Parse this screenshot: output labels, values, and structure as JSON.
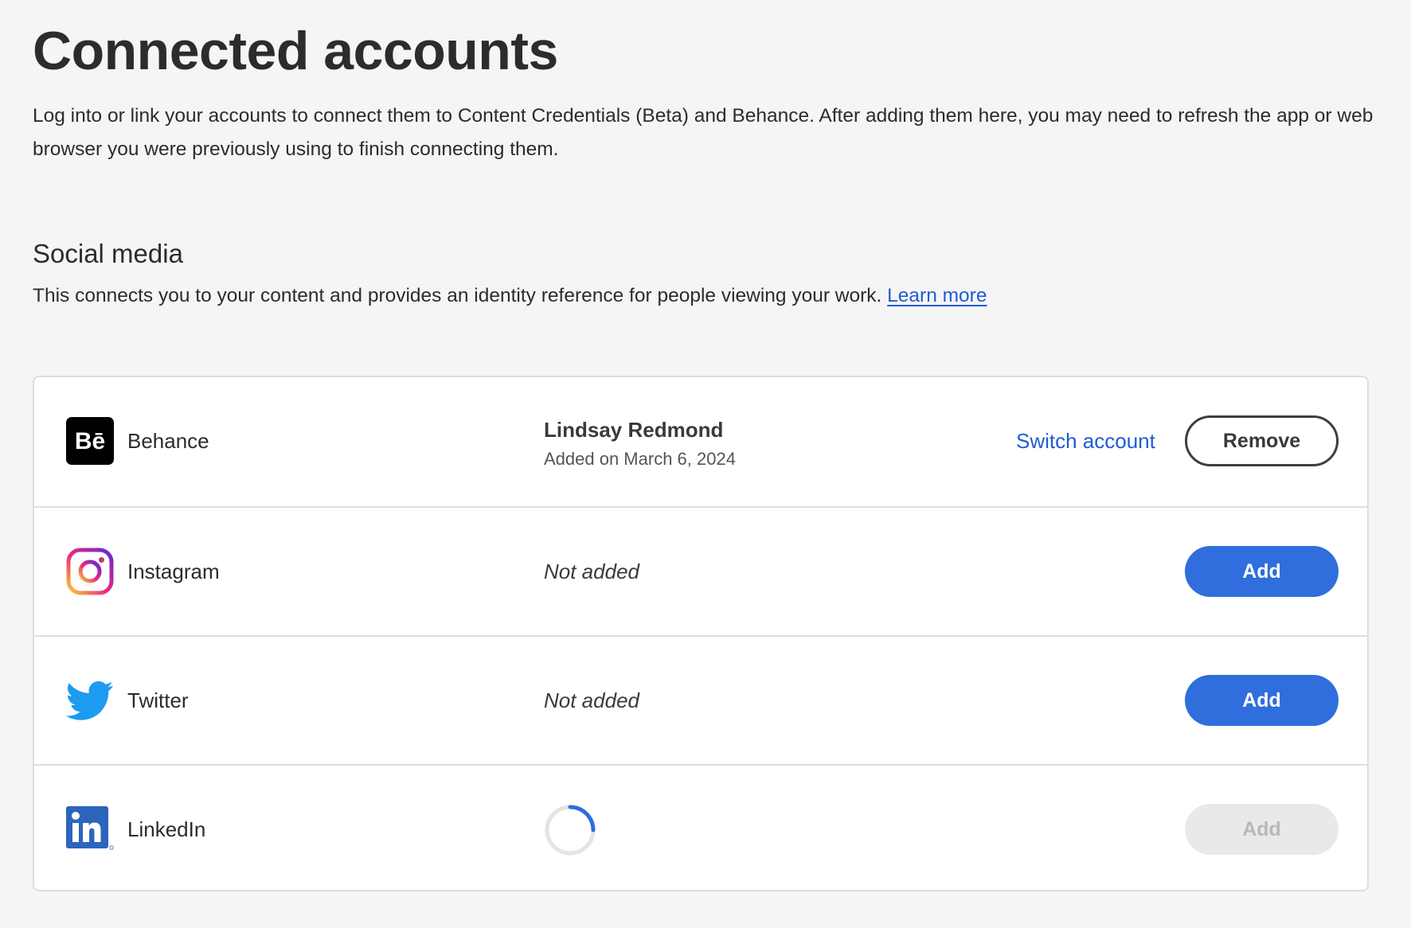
{
  "page": {
    "title": "Connected accounts",
    "intro": "Log into or link your accounts to connect them to Content Credentials (Beta) and Behance. After adding them here, you may need to refresh the app or web browser you were previously using to finish connecting them."
  },
  "social": {
    "title": "Social media",
    "description": "This connects you to your content and provides an identity reference for people viewing your work.",
    "learn_more": "Learn more"
  },
  "accounts": [
    {
      "name": "Behance",
      "icon": "behance-icon",
      "account_name": "Lindsay Redmond",
      "added_date": "Added on March 6, 2024",
      "switch_label": "Switch account",
      "button_label": "Remove"
    },
    {
      "name": "Instagram",
      "icon": "instagram-icon",
      "status": "Not added",
      "button_label": "Add"
    },
    {
      "name": "Twitter",
      "icon": "twitter-icon",
      "status": "Not added",
      "button_label": "Add"
    },
    {
      "name": "LinkedIn",
      "icon": "linkedin-icon",
      "status_indicator": "loading-spinner",
      "button_label": "Add",
      "button_disabled": true
    }
  ],
  "colors": {
    "background": "#f5f5f5",
    "accent_blue": "#2f6edc",
    "link_blue": "#1f5bd6",
    "behance_black": "#000000",
    "twitter_blue": "#1d9bf0",
    "linkedin_blue": "#0a66c2"
  }
}
